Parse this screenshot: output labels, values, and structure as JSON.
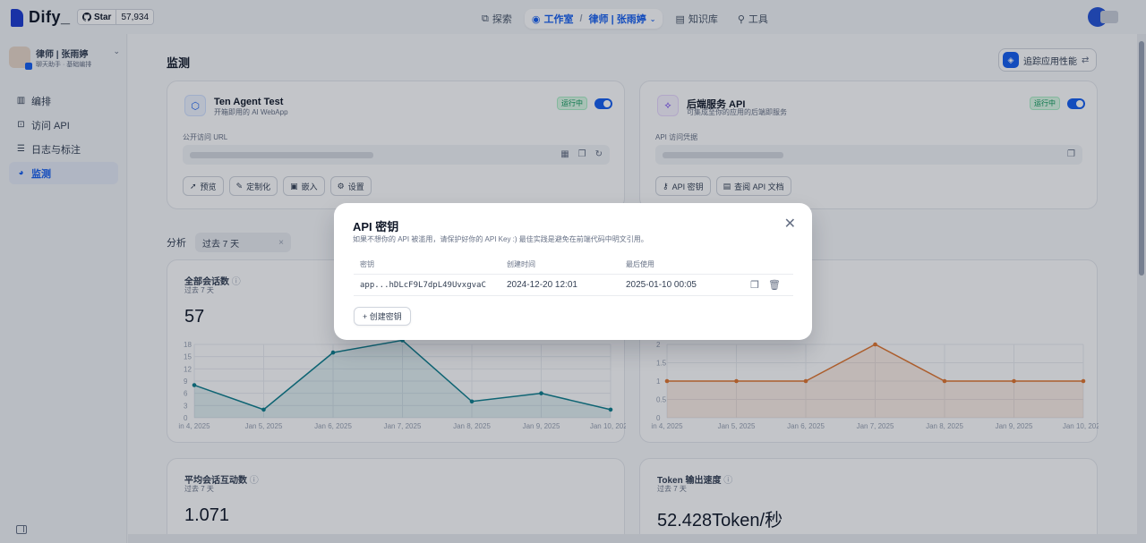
{
  "topbar": {
    "logo_text": "Dify_",
    "github": {
      "star_label": "Star",
      "star_count": "57,934"
    },
    "nav": [
      {
        "label": "探索",
        "icon": "compass-icon",
        "active": false
      },
      {
        "label": "工作室",
        "icon": "studio-icon",
        "active": true
      },
      {
        "label": "律师 | 张雨婷",
        "icon": "",
        "active": true
      },
      {
        "label": "知识库",
        "icon": "book-icon",
        "active": false
      },
      {
        "label": "工具",
        "icon": "tool-icon",
        "active": false
      }
    ]
  },
  "sidebar": {
    "app_name": "律师 | 张雨婷",
    "app_tags": "聊天助手 · 基础编排",
    "items": [
      {
        "label": "编排",
        "icon": "edit-icon"
      },
      {
        "label": "访问 API",
        "icon": "terminal-icon"
      },
      {
        "label": "日志与标注",
        "icon": "file-icon"
      },
      {
        "label": "监测",
        "icon": "monitor-icon",
        "active": true
      }
    ]
  },
  "main": {
    "title": "监测",
    "trace_button": "追踪应用性能",
    "webapp_card": {
      "title": "Ten Agent Test",
      "subtitle": "开箱即用的 AI WebApp",
      "status": "运行中",
      "url_label": "公开访问 URL",
      "buttons": [
        "预览",
        "定制化",
        "嵌入",
        "设置"
      ]
    },
    "api_card": {
      "title": "后端服务 API",
      "subtitle": "可集成至你的应用的后端即服务",
      "status": "运行中",
      "url_label": "API 访问凭据",
      "buttons": [
        "API 密钥",
        "查阅 API 文档"
      ]
    },
    "analysis": {
      "label": "分析",
      "period": "过去 7 天"
    },
    "stats": [
      {
        "title": "全部会话数",
        "period": "过去 7 天",
        "value": "57"
      },
      {
        "title": "平均会话互动数",
        "period": "过去 7 天",
        "value": "1.071"
      },
      {
        "title": "Token 输出速度",
        "period": "过去 7 天",
        "value": "52.428Token/秒"
      }
    ]
  },
  "chart_data": [
    {
      "type": "area",
      "x": [
        "Jan 4, 2025",
        "Jan 5, 2025",
        "Jan 6, 2025",
        "Jan 7, 2025",
        "Jan 8, 2025",
        "Jan 9, 2025",
        "Jan 10, 2025"
      ],
      "x_tick_labels": [
        "in 4, 2025",
        "Jan 5, 2025",
        "Jan 6, 2025",
        "Jan 7, 2025",
        "Jan 8, 2025",
        "Jan 9, 2025",
        "Jan 10, 2025"
      ],
      "values": [
        8,
        2,
        16,
        19,
        4,
        6,
        2
      ],
      "yticks": [
        0,
        3,
        6,
        9,
        12,
        15,
        18
      ],
      "ylim": [
        0,
        18
      ],
      "color": "#0e7e8c"
    },
    {
      "type": "area",
      "x": [
        "Jan 4, 2025",
        "Jan 5, 2025",
        "Jan 6, 2025",
        "Jan 7, 2025",
        "Jan 8, 2025",
        "Jan 9, 2025",
        "Jan 10, 2025"
      ],
      "x_tick_labels": [
        "in 4, 2025",
        "Jan 5, 2025",
        "Jan 6, 2025",
        "Jan 7, 2025",
        "Jan 8, 2025",
        "Jan 9, 2025",
        "Jan 10, 2025"
      ],
      "values": [
        1,
        1,
        1,
        2,
        1,
        1,
        1
      ],
      "yticks": [
        "0",
        "0.5",
        "1",
        "1.5",
        "2"
      ],
      "ylim": [
        0,
        2
      ],
      "color": "#e0762f"
    }
  ],
  "modal": {
    "title": "API 密钥",
    "description": "如果不想你的 API 被滥用，请保护好你的 API Key :) 最佳实践是避免在前端代码中明文引用。",
    "columns": [
      "密钥",
      "创建时间",
      "最后使用"
    ],
    "rows": [
      {
        "key": "app...hDLcF9L7dpL49UvxgvaC",
        "created": "2024-12-20 12:01",
        "last_used": "2025-01-10 00:05"
      }
    ],
    "create_button": "+ 创建密钥"
  }
}
